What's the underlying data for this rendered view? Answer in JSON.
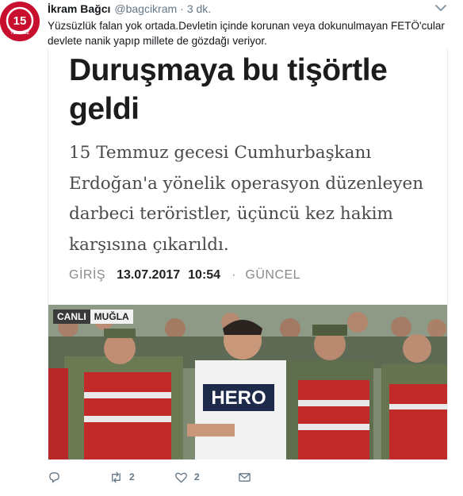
{
  "tweet": {
    "author_name": "İkram Bağcı",
    "author_handle": "@bagcikram",
    "separator": "·",
    "time": "3 dk.",
    "avatar_text": "15",
    "avatar_subtext": "TEMMUZ",
    "text": "Yüzsüzlük falan yok ortada.Devletin içinde korunan veya dokunulmayan FETÖ'cular devlete nanik yapıp millete de gözdağı veriyor.",
    "icons": {
      "more": "chevron-down-icon",
      "reply": "reply-icon",
      "retweet": "retweet-icon",
      "like": "heart-icon",
      "dm": "envelope-icon"
    }
  },
  "card": {
    "headline": "Duruşmaya bu tişörtle geldi",
    "summary": "15 Temmuz gecesi Cumhurbaşkanı Erdoğan'a yönelik operasyon düzenleyen darbeci teröristler, üçüncü kez hakim karşısına çıkarıldı.",
    "meta": {
      "entry_label": "GİRİŞ",
      "date": "13.07.2017",
      "time": "10:54",
      "separator": "·",
      "updated_label": "GÜNCEL"
    },
    "photo": {
      "live_label": "CANLI",
      "location": "MUĞLA",
      "shirt_text": "HERO"
    }
  },
  "actions": {
    "retweet_count": "2",
    "like_count": "2"
  },
  "colors": {
    "accent_red": "#c8102e",
    "text_gray": "#657786"
  }
}
